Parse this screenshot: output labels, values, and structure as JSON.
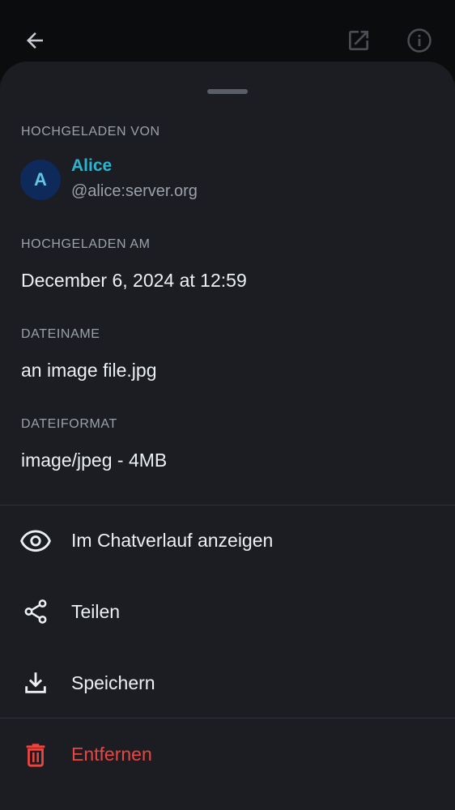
{
  "colors": {
    "accent_name": "#2bb4cf",
    "danger": "#e9463f",
    "sheet_background": "#1b1d22"
  },
  "topbar": {
    "back_icon": "arrow-back-icon",
    "open_external_icon": "open-external-icon",
    "info_icon": "info-icon"
  },
  "uploaded_by": {
    "label": "HOCHGELADEN VON",
    "avatar_letter": "A",
    "name": "Alice",
    "user_id": "@alice:server.org"
  },
  "uploaded_at": {
    "label": "HOCHGELADEN AM",
    "value": "December 6, 2024 at 12:59"
  },
  "filename": {
    "label": "DATEINAME",
    "value": "an image file.jpg"
  },
  "fileformat": {
    "label": "DATEIFORMAT",
    "value": "image/jpeg - 4MB"
  },
  "actions": [
    {
      "label": "Im Chatverlauf anzeigen",
      "icon": "eye-icon"
    },
    {
      "label": "Teilen",
      "icon": "share-icon"
    },
    {
      "label": "Speichern",
      "icon": "download-icon"
    },
    {
      "label": "Entfernen",
      "icon": "trash-icon"
    }
  ]
}
